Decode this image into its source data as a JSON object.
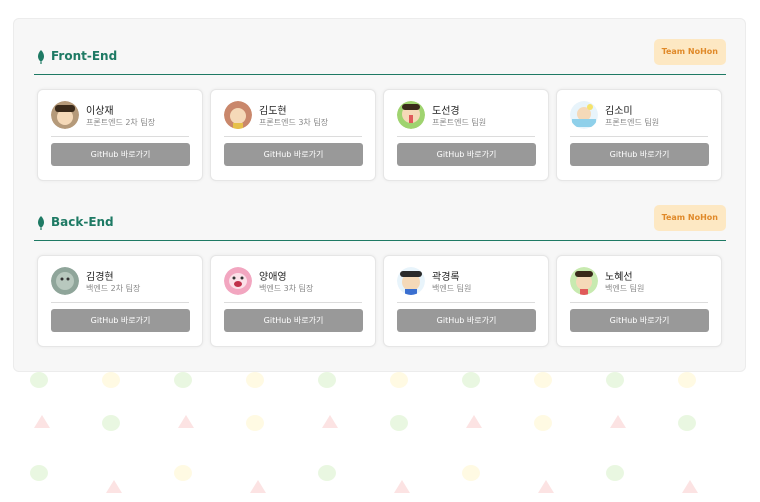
{
  "colors": {
    "accent": "#1e7a64",
    "badge_bg": "#fde8c3",
    "badge_text": "#e08a2a",
    "button_bg": "#999999",
    "panel_bg": "#f7f7f7"
  },
  "sections": [
    {
      "title": "Front-End",
      "badge": "Team NoHon",
      "icon": "leaf-icon",
      "members": [
        {
          "name": "이상재",
          "role": "프론트엔드 2차 팀장",
          "button": "GitHub 바로가기",
          "avatar_color": "#b59a7a"
        },
        {
          "name": "김도현",
          "role": "프론트엔드 3차 팀장",
          "button": "GitHub 바로가기",
          "avatar_color": "#c9876b"
        },
        {
          "name": "도선경",
          "role": "프론트엔드 팀원",
          "button": "GitHub 바로가기",
          "avatar_color": "#9fd36f"
        },
        {
          "name": "김소미",
          "role": "프론트엔드 팀원",
          "button": "GitHub 바로가기",
          "avatar_color": "#bfe0f0"
        }
      ]
    },
    {
      "title": "Back-End",
      "badge": "Team NoHon",
      "icon": "leaf-icon",
      "members": [
        {
          "name": "김경현",
          "role": "백엔드 2차 팀장",
          "button": "GitHub 바로가기",
          "avatar_color": "#8fa59a"
        },
        {
          "name": "양애영",
          "role": "백엔드 3차 팀장",
          "button": "GitHub 바로가기",
          "avatar_color": "#f2a6c0"
        },
        {
          "name": "곽경록",
          "role": "백엔드 팀원",
          "button": "GitHub 바로가기",
          "avatar_color": "#f5d36b"
        },
        {
          "name": "노혜선",
          "role": "백엔드 팀원",
          "button": "GitHub 바로가기",
          "avatar_color": "#f0c090"
        }
      ]
    }
  ]
}
